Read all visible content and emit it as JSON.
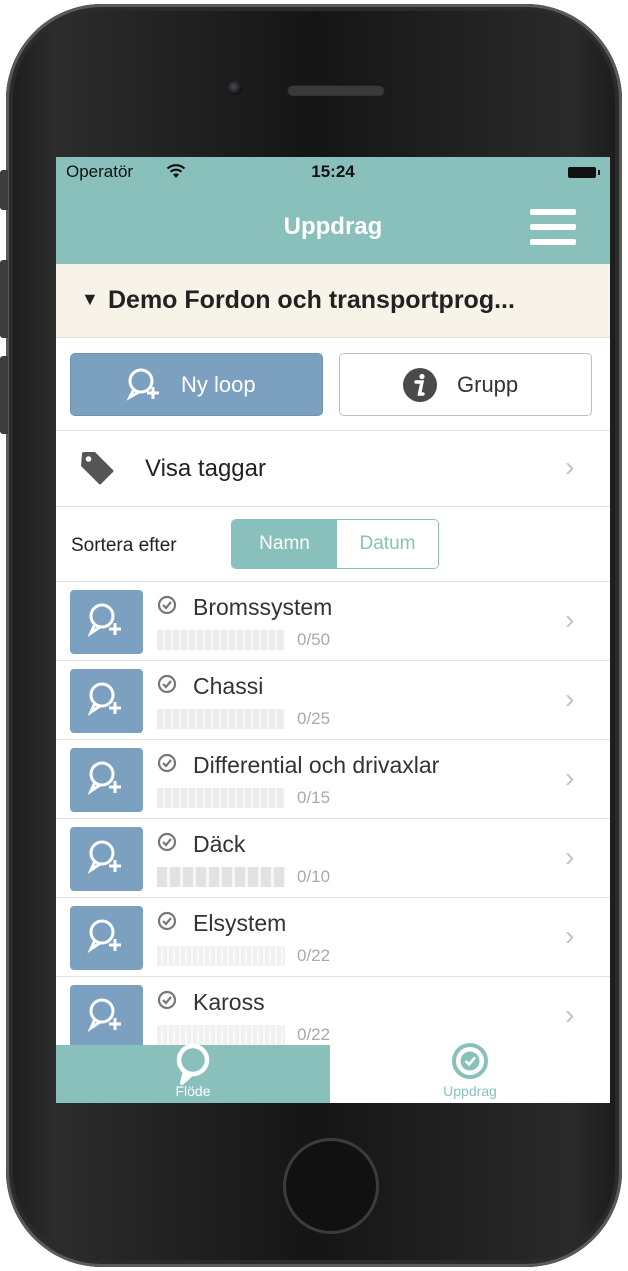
{
  "statusbar": {
    "carrier": "Operatör",
    "time": "15:24"
  },
  "navbar": {
    "title": "Uppdrag"
  },
  "group": {
    "title": "Demo Fordon och transportprog..."
  },
  "buttons": {
    "new_loop": "Ny loop",
    "group": "Grupp"
  },
  "tags": {
    "label": "Visa taggar"
  },
  "sort": {
    "label": "Sortera efter",
    "options": [
      "Namn",
      "Datum"
    ],
    "selected": "Namn"
  },
  "items": [
    {
      "title": "Bromssystem",
      "count": "0/50"
    },
    {
      "title": "Chassi",
      "count": "0/25"
    },
    {
      "title": "Differential och drivaxlar",
      "count": "0/15"
    },
    {
      "title": "Däck",
      "count": "0/10"
    },
    {
      "title": "Elsystem",
      "count": "0/22"
    },
    {
      "title": "Kaross",
      "count": "0/22"
    }
  ],
  "tabs": {
    "flode": "Flöde",
    "uppdrag": "Uppdrag"
  },
  "colors": {
    "teal": "#8ac0bc",
    "blue": "#7ca0c0",
    "cream": "#f8f3e8"
  }
}
